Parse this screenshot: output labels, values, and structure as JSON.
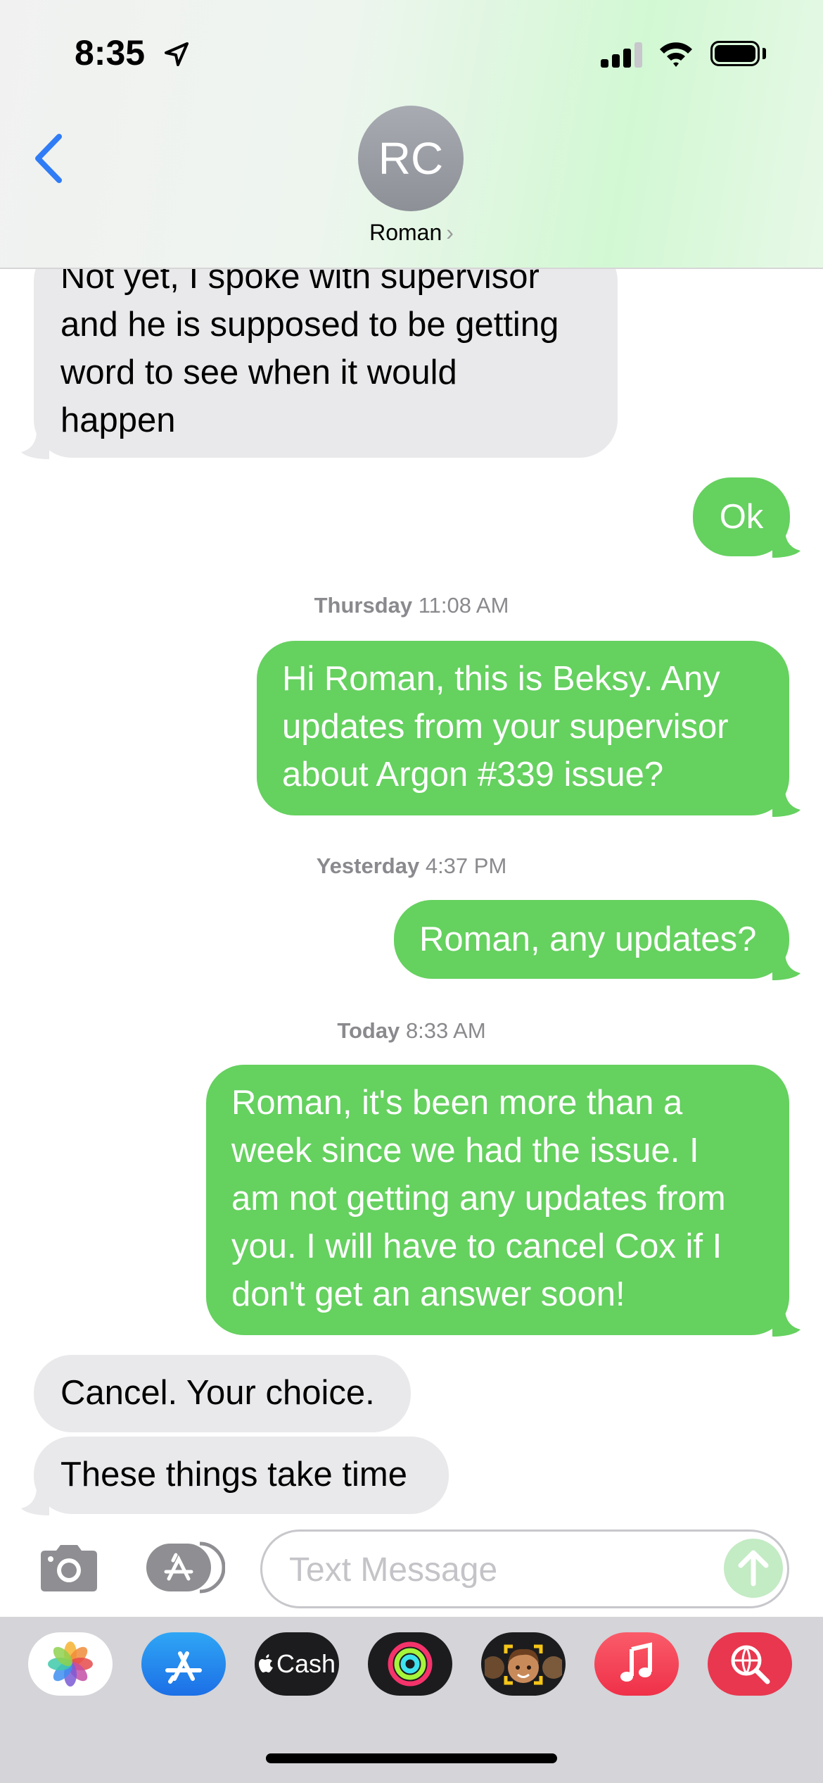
{
  "status_bar": {
    "time": "8:35"
  },
  "header": {
    "avatar_initials": "RC",
    "contact_name": "Roman",
    "contact_chevron": "›"
  },
  "messages": [
    {
      "from": "Roman",
      "lines": [
        "Not yet, I spoke with supervisor",
        "and he is supposed to be getting",
        "word to see when it would",
        "happen"
      ]
    },
    {
      "from": "me",
      "lines": [
        "Ok"
      ]
    },
    {
      "from": "me",
      "lines": [
        "Hi Roman, this is Beksy. Any",
        "updates from your supervisor",
        "about Argon #339 issue?"
      ]
    },
    {
      "from": "me",
      "lines": [
        "Roman, any updates?"
      ]
    },
    {
      "from": "me",
      "lines": [
        "Roman, it's been more than a",
        "week since we had the issue. I",
        "am not getting any updates from",
        "you. I will have to cancel Cox if I",
        "don't get an answer soon!"
      ]
    },
    {
      "from": "Roman",
      "lines": [
        "Cancel. Your choice."
      ]
    },
    {
      "from": "Roman",
      "lines": [
        "These things take time"
      ]
    }
  ],
  "timestamps": [
    {
      "day": "Thursday",
      "time": "11:08 AM"
    },
    {
      "day": "Yesterday",
      "time": "4:37 PM"
    },
    {
      "day": "Today",
      "time": "8:33 AM"
    }
  ],
  "input": {
    "placeholder": "Text Message"
  },
  "app_drawer": [
    {
      "name": "Photos",
      "icon": "photos-icon"
    },
    {
      "name": "App Store",
      "icon": "app-store-icon"
    },
    {
      "name": "Cash",
      "label": "Cash",
      "icon": "apple-cash-icon"
    },
    {
      "name": "Activity",
      "icon": "activity-rings-icon"
    },
    {
      "name": "Memoji",
      "icon": "memoji-icon"
    },
    {
      "name": "Music",
      "icon": "music-note-icon"
    },
    {
      "name": "Search",
      "icon": "web-search-icon"
    }
  ],
  "colors": {
    "sent_bubble": "#65d15f",
    "received_bubble": "#e9e9eb",
    "link_blue": "#2f7cf6"
  }
}
